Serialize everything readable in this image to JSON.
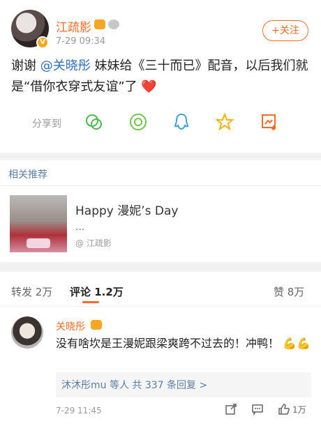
{
  "post": {
    "username": "江疏影",
    "time": "7-29 09:34",
    "follow_label": "+关注",
    "text_before": "谢谢",
    "mention": "@关晓彤",
    "text_after": " 妹妹给《三十而已》配音，以后我们就是“借你衣穿式友谊”了",
    "emoji": "❤️",
    "share_label": "分享到",
    "share_icons": [
      "wechat-icon",
      "moments-icon",
      "qq-icon",
      "qzone-icon",
      "save-image-icon"
    ]
  },
  "related": {
    "title": "相关推荐",
    "headline": "Happy 漫妮’s Day",
    "dots": "...",
    "author": "@ 江疏影"
  },
  "tabs": {
    "repost": "转发 2万",
    "comment": "评论 1.2万",
    "like": "赞 8万"
  },
  "comment": {
    "username": "关晓彤",
    "text": "没有啥坎是王漫妮跟梁爽跨不过去的！冲鸭！",
    "emoji": "💪💪",
    "reply_summary": "沐沐彤mu 等人  共 337 条回复 >",
    "time": "7-29 11:45",
    "like_count": "1万"
  },
  "colors": {
    "accent": "#f86b20",
    "link": "#2f6fbf",
    "muted": "#999999"
  }
}
